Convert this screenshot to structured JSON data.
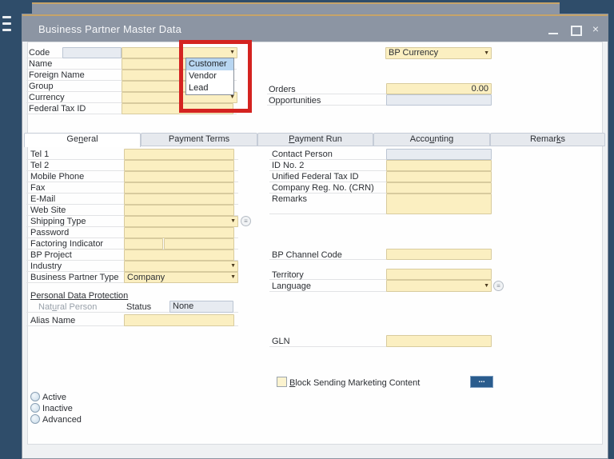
{
  "icons": {
    "dropdown_arrow": "▼",
    "close": "×",
    "ellipsis": "...",
    "choose_from_list": "≡"
  },
  "window": {
    "title": "Business Partner Master Data"
  },
  "top": {
    "code": {
      "label": "Code"
    },
    "name": {
      "label": "Name"
    },
    "foreign_name": {
      "label": "Foreign Name"
    },
    "group": {
      "label": "Group"
    },
    "currency": {
      "label": "Currency"
    },
    "federal_tax_id": {
      "label": "Federal Tax ID"
    },
    "bp_type": {
      "options": [
        "Customer",
        "Vendor",
        "Lead"
      ],
      "selected": "Customer"
    },
    "bp_currency": {
      "value": "BP Currency"
    },
    "orders": {
      "label": "Orders",
      "value": "0.00"
    },
    "opportunities": {
      "label": "Opportunities"
    }
  },
  "tabs": {
    "items": [
      {
        "pre": "Ge",
        "key": "n",
        "post": "eral"
      },
      {
        "pre": "Payment Terms",
        "key": "",
        "post": ""
      },
      {
        "pre": "",
        "key": "P",
        "post": "ayment Run"
      },
      {
        "pre": "Acco",
        "key": "u",
        "post": "nting"
      },
      {
        "pre": "Remar",
        "key": "k",
        "post": "s"
      }
    ]
  },
  "general": {
    "tel1": "Tel 1",
    "tel2": "Tel 2",
    "mobile_phone": "Mobile Phone",
    "fax": "Fax",
    "email": "E-Mail",
    "web_site": "Web Site",
    "shipping_type": "Shipping Type",
    "password": "Password",
    "factoring_indicator": "Factoring Indicator",
    "bp_project": "BP Project",
    "industry": "Industry",
    "business_partner_type": {
      "label": "Business Partner Type",
      "value": "Company"
    },
    "pdp": {
      "title": "Personal Data Protection",
      "natural_person": {
        "pre": "Nat",
        "key": "u",
        "post": "ral Person"
      },
      "status_label": "Status",
      "status_value": "None",
      "alias_name": "Alias Name"
    },
    "contact_person": "Contact Person",
    "id_no_2": "ID No. 2",
    "unified_federal_tax_id": "Unified Federal Tax ID",
    "company_reg_no": "Company Reg. No. (CRN)",
    "remarks": "Remarks",
    "bp_channel_code": "BP Channel Code",
    "territory": "Territory",
    "language": "Language",
    "gln": "GLN",
    "marketing": {
      "pre": "",
      "key": "B",
      "post": "lock Sending Marketing Content"
    }
  },
  "status_radios": [
    "Active",
    "Inactive",
    "Advanced"
  ],
  "colors": {
    "desktop": "#2f4d6a",
    "titlebar": "#8c95a3",
    "accent_gold": "#c6a469",
    "field_yellow": "#fbefc1",
    "field_gray": "#e7ebf1",
    "highlight_red": "#d42320",
    "selection_blue": "#b8d6f1",
    "button_navy": "#2a5c8d"
  }
}
